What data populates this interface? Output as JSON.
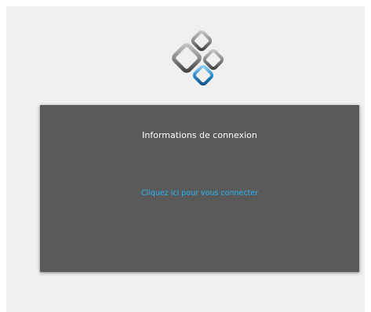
{
  "logo": {
    "icon": "diamond-squares-logo-icon",
    "accent_color": "#2a8fd0",
    "frame_color": "#6e6e6e"
  },
  "panel": {
    "title": "Informations de connexion",
    "login_link_label": "Cliquez ici pour vous connecter",
    "link_color": "#29b6f6",
    "background_color": "#5a5a5a"
  }
}
